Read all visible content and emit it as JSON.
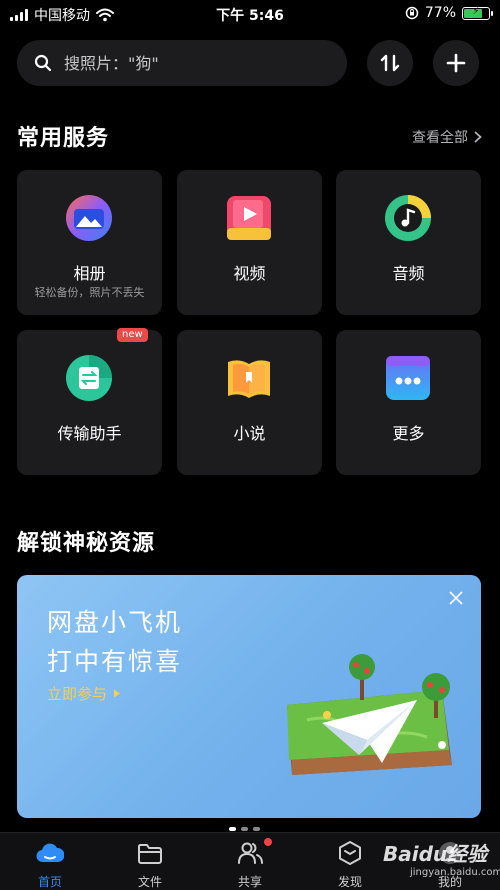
{
  "status_bar": {
    "carrier": "中国移动",
    "time": "下午 5:46",
    "battery_percent": "77%",
    "battery_level": 0.77,
    "icons": [
      "signal-icon",
      "wifi-icon",
      "rotation-lock-icon",
      "battery-icon"
    ]
  },
  "search": {
    "placeholder": "搜照片：\"狗\""
  },
  "header_buttons": [
    "sort-icon",
    "plus-icon"
  ],
  "services": {
    "title": "常用服务",
    "see_all": "查看全部",
    "items": [
      {
        "label": "相册",
        "sub": "轻松备份，照片不丢失",
        "icon": "album-icon"
      },
      {
        "label": "视频",
        "sub": "",
        "icon": "video-icon"
      },
      {
        "label": "音频",
        "sub": "",
        "icon": "audio-icon"
      },
      {
        "label": "传输助手",
        "sub": "",
        "icon": "transfer-icon",
        "badge": "new"
      },
      {
        "label": "小说",
        "sub": "",
        "icon": "novel-icon"
      },
      {
        "label": "更多",
        "sub": "",
        "icon": "more-icon"
      }
    ]
  },
  "unlock": {
    "title": "解锁神秘资源",
    "banner": {
      "line1": "网盘小飞机",
      "line2": "打中有惊喜",
      "link": "立即参与"
    }
  },
  "tabs": [
    {
      "label": "首页",
      "icon": "home-cloud-icon",
      "active": true
    },
    {
      "label": "文件",
      "icon": "folder-icon"
    },
    {
      "label": "共享",
      "icon": "share-people-icon",
      "dot": true
    },
    {
      "label": "发现",
      "icon": "discover-box-icon"
    },
    {
      "label": "我的",
      "icon": "profile-icon"
    }
  ],
  "watermark": {
    "brand": "Baidu经验",
    "url": "jingyan.baidu.com"
  },
  "colors": {
    "accent": "#2f8cf5",
    "badge": "#ef4848",
    "banner_link": "#f6cf57"
  }
}
